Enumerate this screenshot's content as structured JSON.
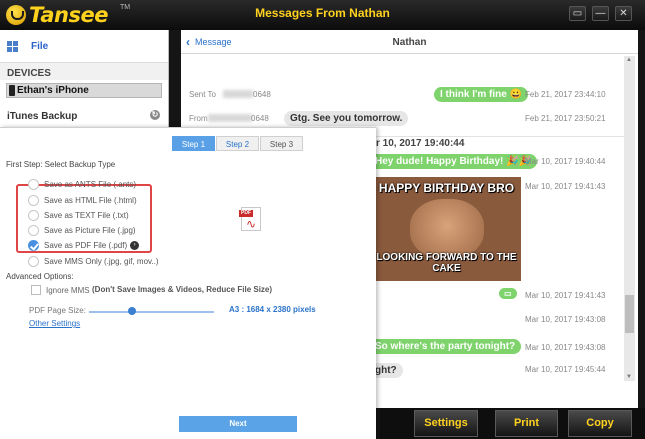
{
  "window": {
    "logo_text": "Tansee",
    "logo_tm": "TM",
    "title": "Messages From Nathan",
    "controls": [
      "▭",
      "—",
      "✕"
    ]
  },
  "sidebar": {
    "file_label": "File",
    "devices_header": "DEVICES",
    "device_name": "Ethan's iPhone",
    "itunes_label": "iTunes Backup"
  },
  "messages_header": {
    "back_label": "Message",
    "contact": "Nathan"
  },
  "messages": [
    {
      "kind": "sent-to",
      "label": "Sent To",
      "number_tail": "0648",
      "bubble": "I think I'm fine 😀",
      "bubble_style": "green",
      "time": "Feb 21, 2017 23:44:10"
    },
    {
      "kind": "from",
      "label": "From",
      "number_tail": "0648",
      "bubble": "Gtg. See you tomorrow.",
      "bubble_style": "gray",
      "time": "Feb 21, 2017 23:50:21"
    },
    {
      "kind": "date-divider",
      "text": "r 10, 2017 19:40:44"
    },
    {
      "kind": "bubble",
      "bubble": "Hey dude! Happy Birthday! 🎉🎉",
      "bubble_style": "green",
      "time": "Mar 10, 2017 19:40:44"
    },
    {
      "kind": "image",
      "meme_top": "HAPPY BIRTHDAY BRO",
      "meme_bottom": "LOOKING FORWARD TO THE CAKE",
      "time": "Mar 10, 2017 19:41:43"
    },
    {
      "kind": "small-green",
      "bubble": "▭",
      "time": "Mar 10, 2017 19:41:43"
    },
    {
      "kind": "plain",
      "time": "Mar 10, 2017 19:43:08"
    },
    {
      "kind": "bubble",
      "bubble": "So where's the party tonight?",
      "bubble_style": "green",
      "time": "Mar 10, 2017 19:43:08"
    },
    {
      "kind": "bubble",
      "bubble": "ght?",
      "bubble_style": "gray",
      "time": "Mar 10, 2017 19:45:44"
    }
  ],
  "bottom_buttons": {
    "settings": "Settings",
    "print": "Print",
    "copy": "Copy"
  },
  "dialog": {
    "steps": [
      "Step 1",
      "Step 2",
      "Step 3"
    ],
    "active_step": 1,
    "first_step_label": "First Step: Select Backup Type",
    "options": [
      {
        "label": "Save as ANTS File (.ants)",
        "selected": false
      },
      {
        "label": "Save as HTML File (.html)",
        "selected": false
      },
      {
        "label": "Save as TEXT File (.txt)",
        "selected": false
      },
      {
        "label": "Save as Picture File (.jpg)",
        "selected": false
      },
      {
        "label": "Save as PDF File (.pdf)",
        "selected": true
      },
      {
        "label": "Save MMS Only (.jpg, gif, mov..)",
        "selected": false
      }
    ],
    "pdf_tag": "PDF",
    "advanced_label": "Advanced Options:",
    "ignore_mms_label": "Ignore MMS",
    "ignore_mms_hint": "(Don't Save Images & Videos, Reduce File Size)",
    "ignore_mms_checked": false,
    "page_size_label": "PDF Page Size:",
    "page_size_value": "A3 : 1684 x 2380 pixels",
    "page_size_level": 0.34,
    "other_settings": "Other Settings",
    "next_label": "Next"
  },
  "colors": {
    "accent_yellow": "#ffd21e",
    "bubble_green": "#7ed36c",
    "step_blue": "#5aa0e6",
    "highlight_red": "#e04545"
  }
}
